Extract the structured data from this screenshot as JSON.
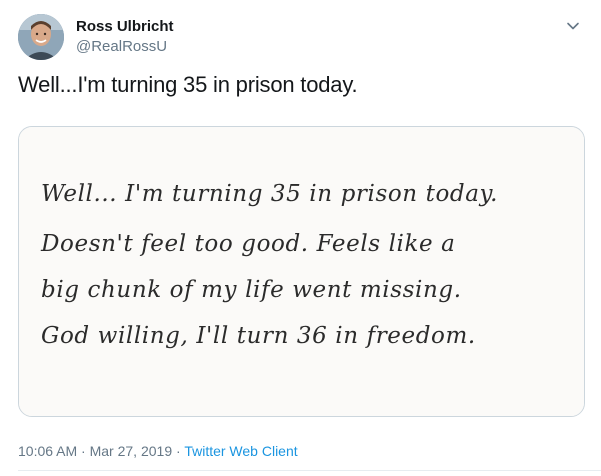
{
  "user": {
    "name": "Ross Ulbricht",
    "handle": "@RealRossU"
  },
  "tweet": {
    "text": "Well...I'm turning 35 in prison today.",
    "handwritten_lines": [
      "Well... I'm turning 35 in prison today.",
      "Doesn't feel too good. Feels like a",
      "big chunk of my life went missing.",
      "God willing, I'll turn 36 in freedom."
    ],
    "time": "10:06 AM",
    "separator": "·",
    "date": "Mar 27, 2019",
    "client": "Twitter Web Client"
  },
  "icons": {
    "caret": "chevron-down-icon"
  },
  "colors": {
    "link": "#1b95e0",
    "secondary_text": "#657786",
    "primary_text": "#14171a",
    "border": "#ccd6dd"
  }
}
